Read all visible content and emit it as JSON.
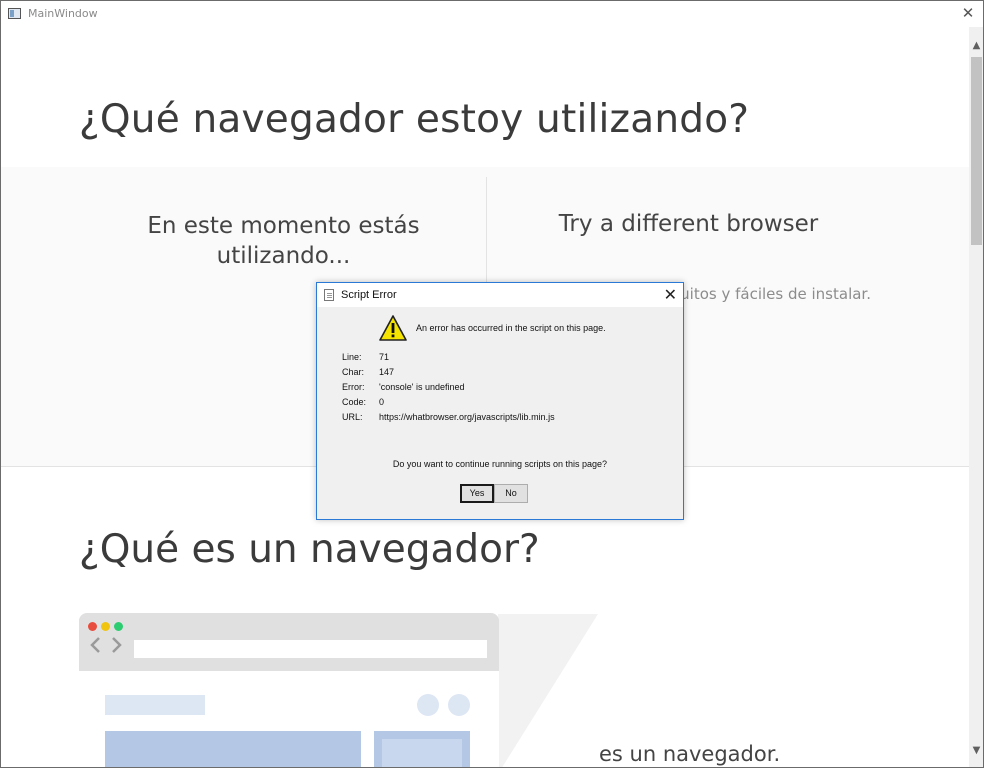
{
  "window": {
    "title": "MainWindow",
    "close": "✕"
  },
  "page": {
    "heading": "¿Qué navegador estoy utilizando?",
    "left_col": "En este momento estás utilizando...",
    "right_col": "Try a different browser",
    "right_sub": "tuitos y fáciles de instalar.",
    "heading2": "¿Qué es un navegador?",
    "browser_text": "es un navegador."
  },
  "scrollbar": {
    "up": "▲",
    "down": "▼"
  },
  "dialog": {
    "title": "Script Error",
    "close": "✕",
    "message": "An error has occurred in the script on this page.",
    "details": [
      {
        "key": "Line:",
        "value": "71"
      },
      {
        "key": "Char:",
        "value": "147"
      },
      {
        "key": "Error:",
        "value": "'console' is undefined"
      },
      {
        "key": "Code:",
        "value": "0"
      },
      {
        "key": "URL:",
        "value": "https://whatbrowser.org/javascripts/lib.min.js"
      }
    ],
    "question": "Do you want to continue running scripts on this page?",
    "yes_label": "Yes",
    "no_label": "No"
  },
  "illustration": {
    "nav": "<>"
  },
  "colors": {
    "accent": "#2b79d6",
    "warning": "#f5e400"
  }
}
